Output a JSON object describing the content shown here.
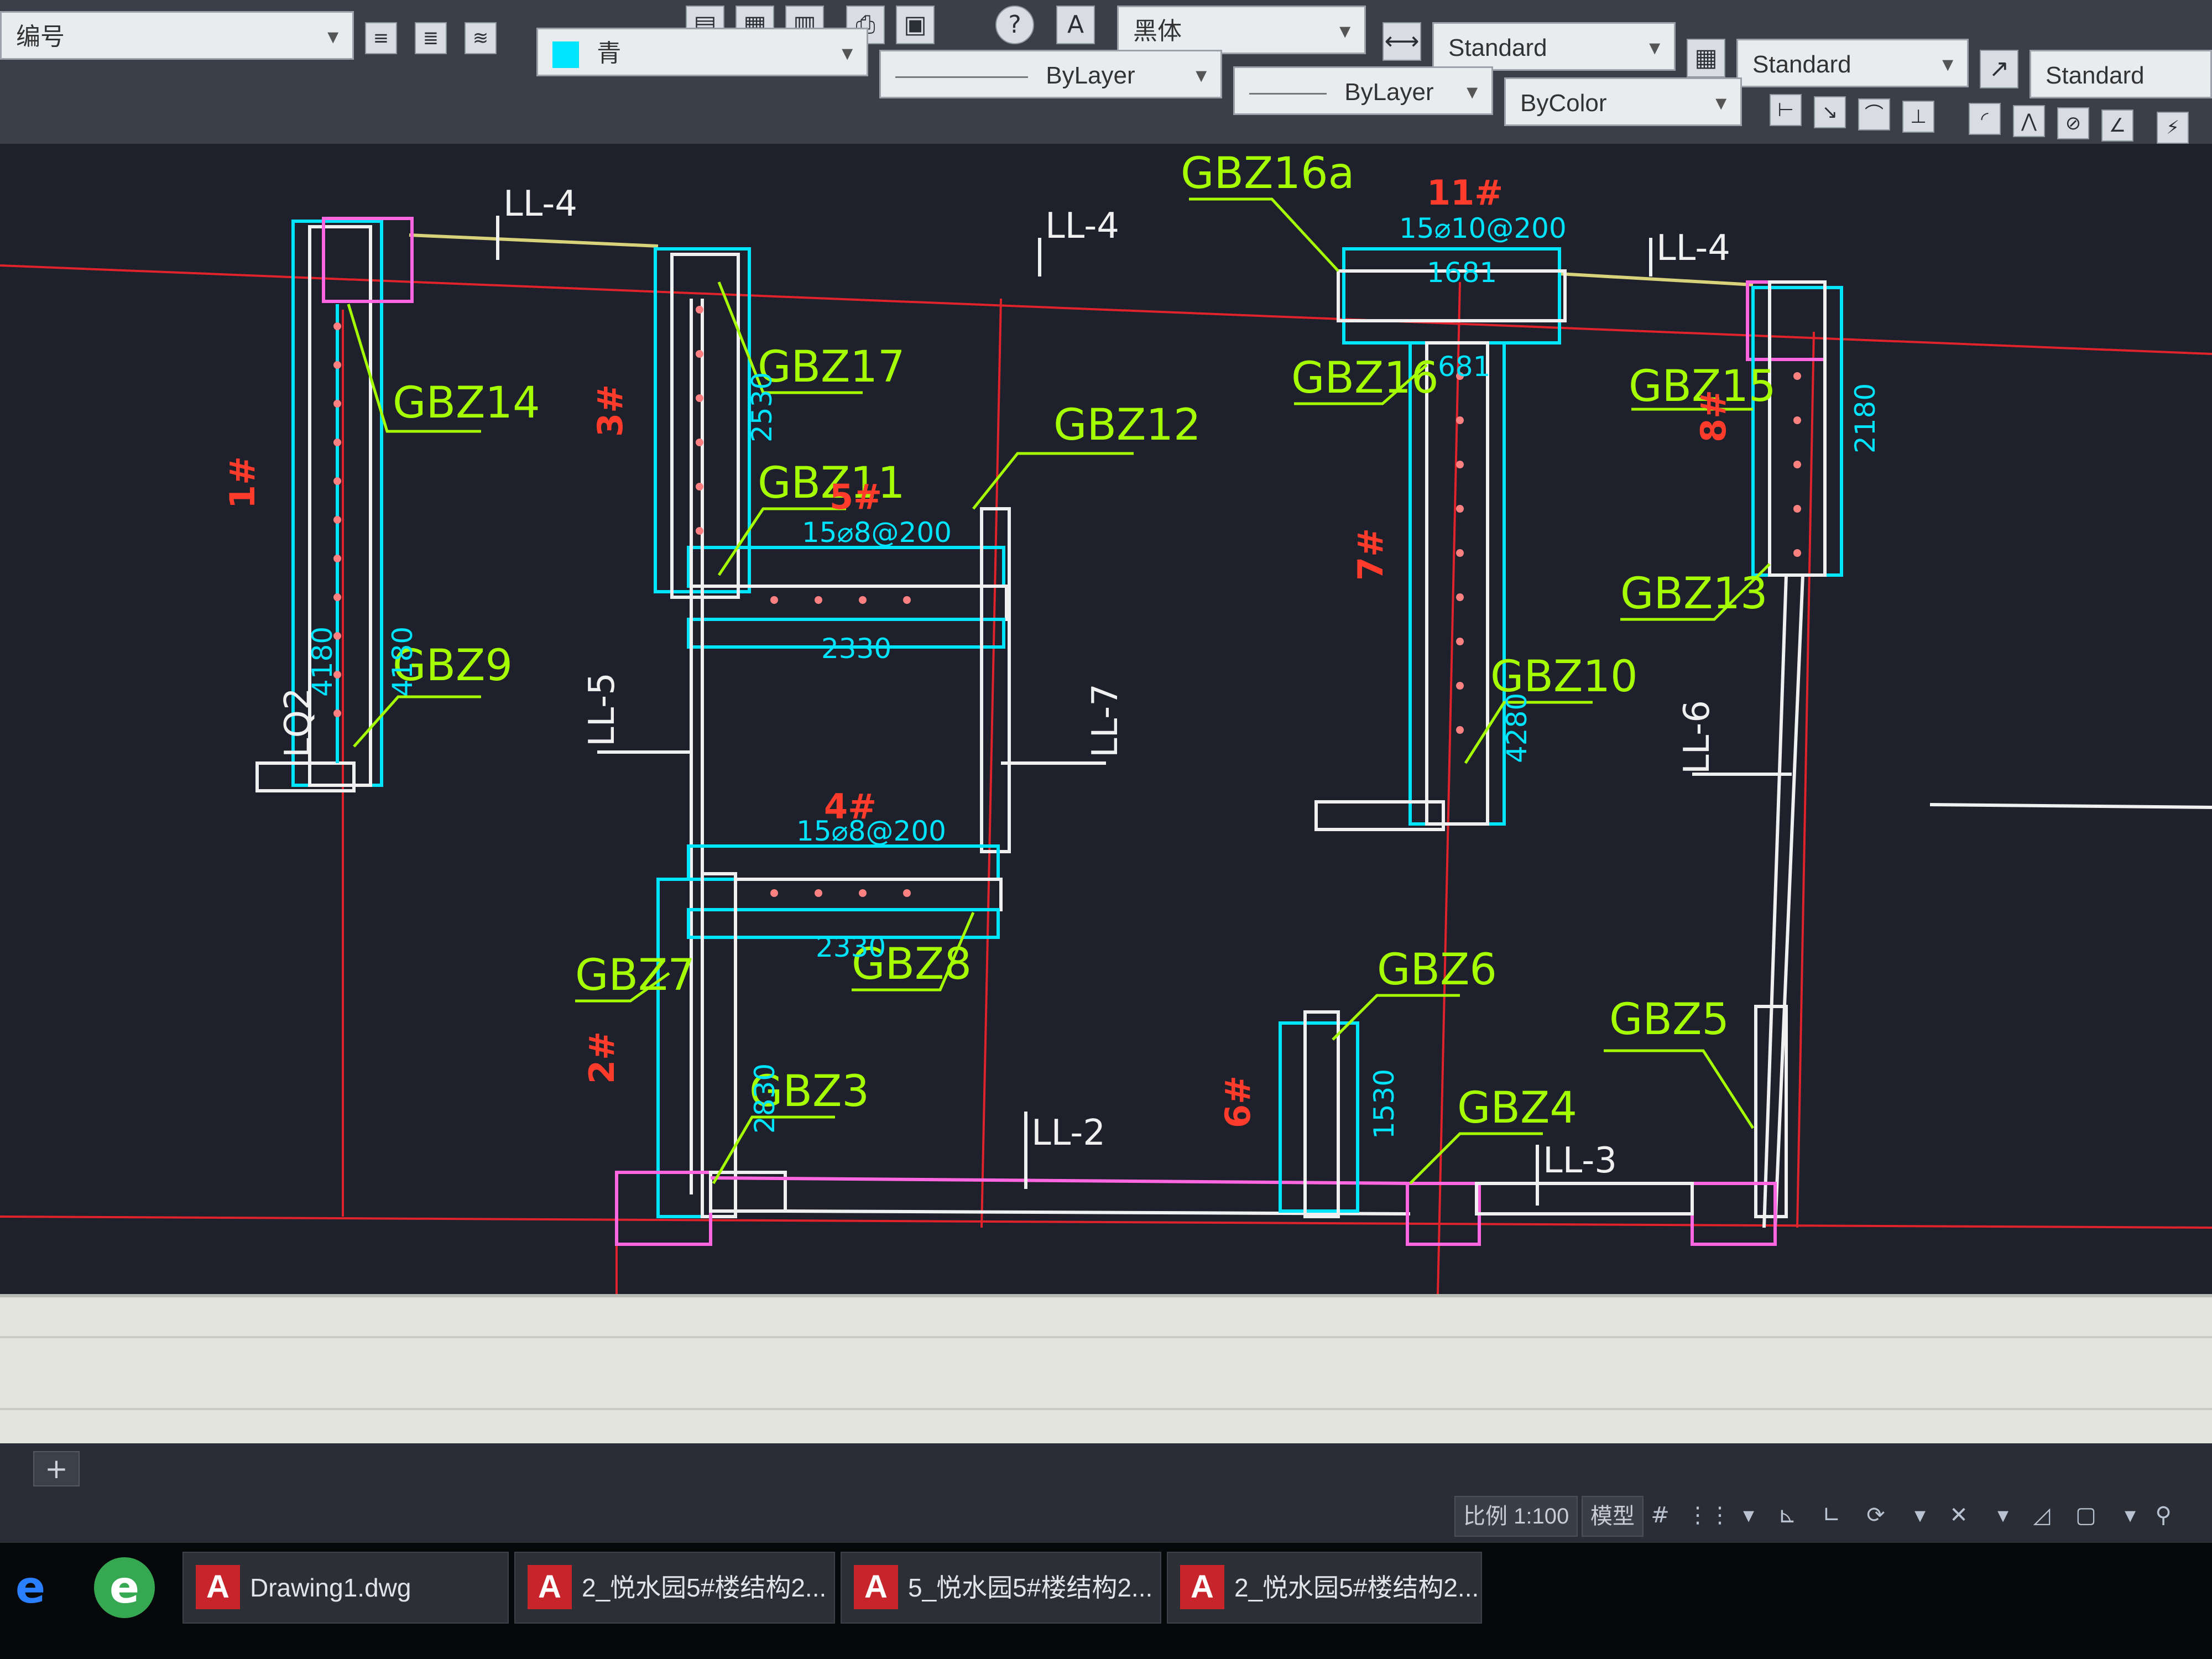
{
  "toolbar": {
    "layer_name": "编号",
    "color_value": "青",
    "linetype_value": "ByLayer",
    "lineweight_value": "ByLayer",
    "plotstyle_value": "ByColor",
    "font_value": "黑体",
    "dim_style": "Standard",
    "table_style": "Standard",
    "multileader_style": "Standard",
    "icons": [
      "layer-icon",
      "layer-state-icon",
      "layer-previous-icon",
      "help-icon",
      "text-style-icon",
      "dim-style-icon",
      "table-style-icon",
      "mleader-style-icon",
      "dimension-icons"
    ]
  },
  "drawing": {
    "layout_colors": {
      "axis": "#e0222a",
      "wall": "#00e5ff",
      "pink": "#ff66e0",
      "label": "#a6ff00",
      "number": "#ff3b2b",
      "white": "#f0f0f0"
    },
    "column_labels": [
      "GBZ14",
      "GBZ9",
      "GBZ17",
      "GBZ11",
      "GBZ12",
      "GBZ16a",
      "GBZ16",
      "GBZ15",
      "GBZ13",
      "GBZ10",
      "GBZ7",
      "GBZ8",
      "GBZ3",
      "GBZ6",
      "GBZ5",
      "GBZ4"
    ],
    "beam_labels": [
      "LL-4",
      "LL-4",
      "LL-4",
      "LL-5",
      "LL-7",
      "LL-6",
      "LL-2",
      "LL-3"
    ],
    "zone_numbers": [
      "1#",
      "2#",
      "3#",
      "4#",
      "5#",
      "6#",
      "7#",
      "8#",
      "11#"
    ],
    "rebar_texts": [
      "15⌀8@200",
      "15⌀10@200",
      "15⌀8@200",
      "2330",
      "2330",
      "4180",
      "4180",
      "2530",
      "4280",
      "2180",
      "2830",
      "1530",
      "1681",
      "681",
      "LQ2"
    ]
  },
  "statusbar": {
    "scale": "比例 1:100",
    "model": "模型",
    "add_tab": "+"
  },
  "taskbar": {
    "windows": [
      "Drawing1.dwg",
      "2_悦水园5#楼结构2...",
      "5_悦水园5#楼结构2...",
      "2_悦水园5#楼结构2..."
    ]
  }
}
